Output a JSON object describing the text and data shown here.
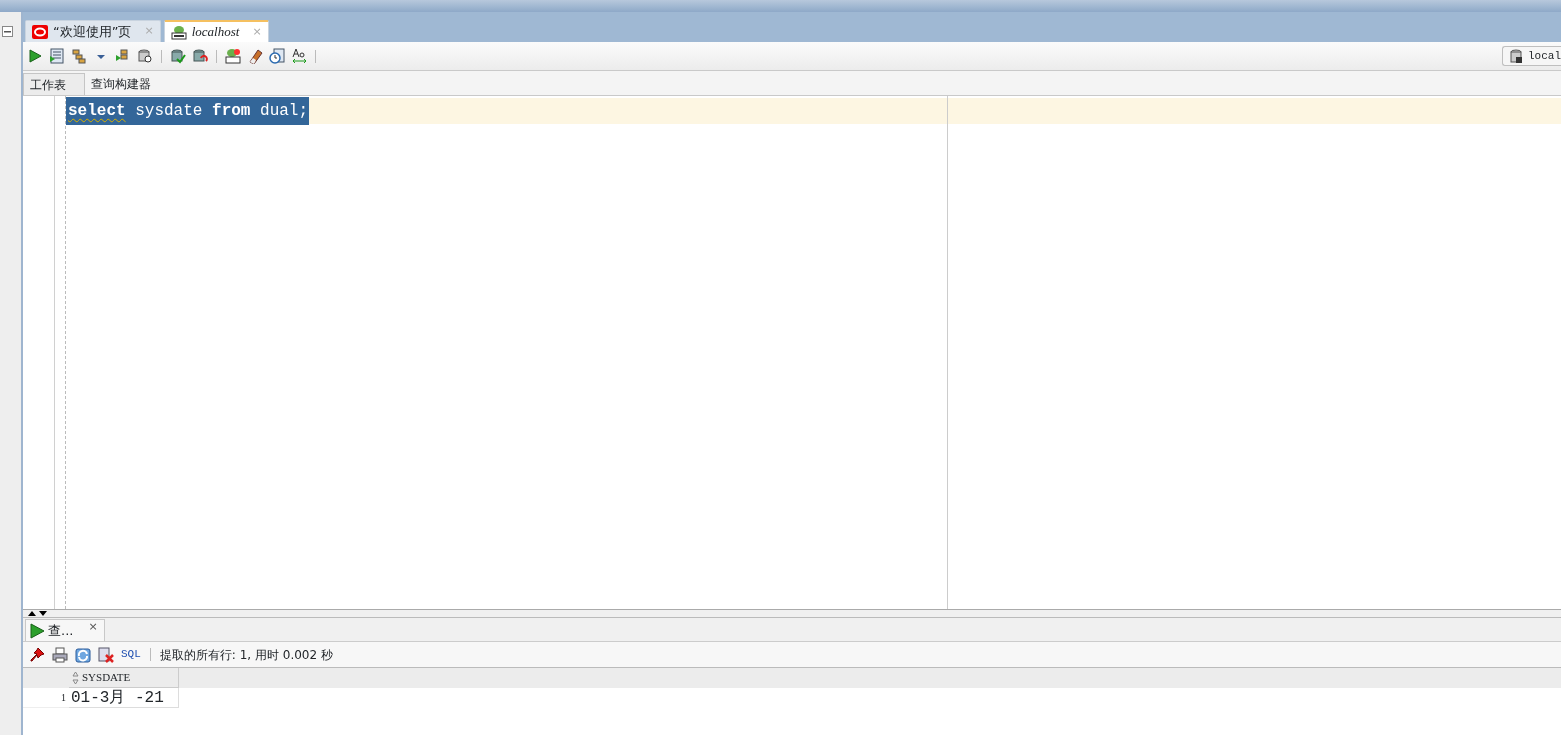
{
  "editor_tabs": [
    {
      "label": "“欢迎使用”页",
      "selected": false,
      "close": "×"
    },
    {
      "label": "localhost",
      "selected": true,
      "close": "×"
    }
  ],
  "connection": {
    "label": "local"
  },
  "sub_tabs": [
    {
      "label": "工作表",
      "selected": true
    },
    {
      "label": "查询构建器",
      "selected": false
    }
  ],
  "editor": {
    "lines": [
      {
        "selected": true,
        "tokens": [
          {
            "text": "select",
            "kind": "keyword"
          },
          {
            "text": " sysdate ",
            "kind": "plain"
          },
          {
            "text": "from",
            "kind": "keyword"
          },
          {
            "text": " dual;",
            "kind": "plain"
          }
        ]
      }
    ]
  },
  "results": {
    "tab": {
      "label": "查...",
      "close": "×"
    },
    "sql_link": "SQL",
    "status": "提取的所有行: 1, 用时 0.002 秒",
    "table": {
      "columns": [
        "SYSDATE"
      ],
      "rows": [
        {
          "number": "1",
          "cells": [
            "01-3月 -21"
          ]
        }
      ]
    }
  }
}
